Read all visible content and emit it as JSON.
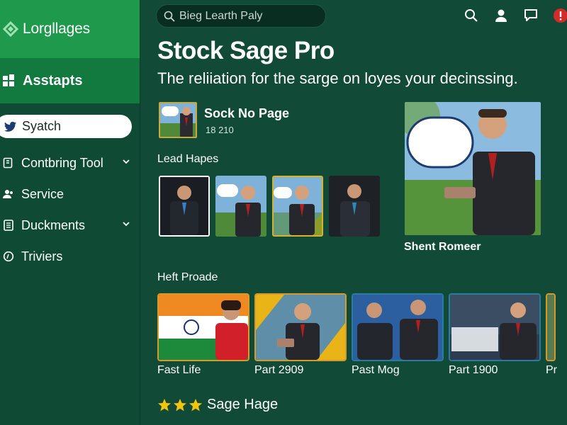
{
  "sidebar": {
    "brand": "Lorgllages",
    "section": "Asstapts",
    "search_label": "Syatch",
    "items": [
      {
        "label": "Contbring Tool",
        "icon": "tool-icon",
        "has_chevron": true
      },
      {
        "label": "Service",
        "icon": "people-icon",
        "has_chevron": false
      },
      {
        "label": "Duckments",
        "icon": "document-icon",
        "has_chevron": true
      },
      {
        "label": "Triviers",
        "icon": "circle-icon",
        "has_chevron": false
      }
    ]
  },
  "header": {
    "search_placeholder": "Bieg Learth Paly",
    "icons": [
      "search-icon",
      "user-icon",
      "chat-icon",
      "alert-icon"
    ]
  },
  "main": {
    "title": "Stock Sage Pro",
    "subtitle": "The reliiation for the sarge on loyes your decinssing.",
    "feature": {
      "name": "Sock No Page",
      "count": "18 210"
    },
    "lead_label": "Lead Hapes",
    "big_card_caption": "Shent Romeer",
    "heft_label": "Heft Proade",
    "heft_items": [
      {
        "caption": "Fast Life"
      },
      {
        "caption": "Part 2909"
      },
      {
        "caption": "Past Mog"
      },
      {
        "caption": "Part 1900"
      },
      {
        "caption": "Pr"
      }
    ],
    "rating": {
      "stars": 3,
      "label": "Sage Hage"
    }
  },
  "colors": {
    "background": "#114a36",
    "brand_green": "#1f9a4c",
    "section_green": "#137a3f",
    "gold_border": "#d8b22c",
    "star": "#f2c40c"
  }
}
